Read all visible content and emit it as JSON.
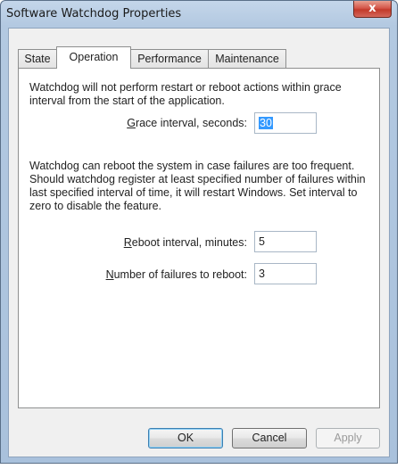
{
  "window": {
    "title": "Software Watchdog Properties",
    "close_glyph": "x"
  },
  "tabs": [
    {
      "label": "State",
      "active": false
    },
    {
      "label": "Operation",
      "active": true
    },
    {
      "label": "Performance",
      "active": false
    },
    {
      "label": "Maintenance",
      "active": false
    }
  ],
  "operation": {
    "grace_description": "Watchdog will not perform restart or reboot actions within grace interval from the start of the application.",
    "grace_label_accel": "G",
    "grace_label_rest": "race interval, seconds:",
    "grace_value": "30",
    "reboot_description": "Watchdog can reboot the system in case failures are too frequent. Should watchdog register at least specified number of failures within last specified interval of time, it will restart Windows. Set interval to zero to disable the feature.",
    "reboot_interval_label_accel": "R",
    "reboot_interval_label_rest": "eboot interval, minutes:",
    "reboot_interval_value": "5",
    "failures_label_accel": "N",
    "failures_label_rest": "umber of failures to reboot:",
    "failures_value": "3"
  },
  "buttons": {
    "ok": "OK",
    "cancel": "Cancel",
    "apply": "Apply"
  }
}
